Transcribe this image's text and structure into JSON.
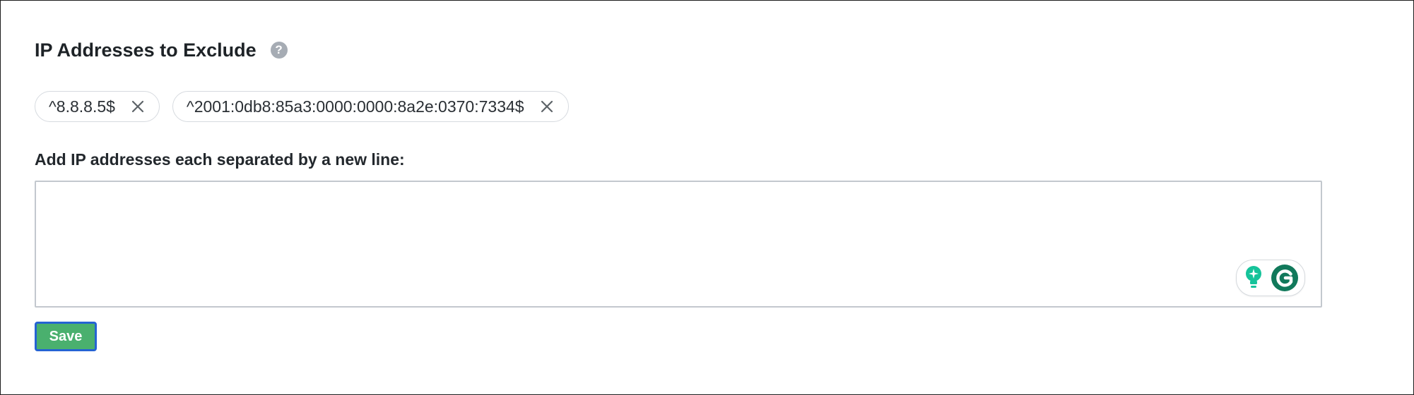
{
  "section": {
    "title": "IP Addresses to Exclude",
    "help_icon": "?",
    "chips": [
      {
        "value": "^8.8.8.5$"
      },
      {
        "value": "^2001:0db8:85a3:0000:0000:8a2e:0370:7334$"
      }
    ],
    "textarea_label": "Add IP addresses each separated by a new line:",
    "textarea_value": "",
    "save_label": "Save"
  },
  "icons": {
    "help": "question-circle-icon",
    "chip_remove": "close-icon",
    "grammarly_suggestion": "lightbulb-icon",
    "grammarly_logo": "grammarly-logo-icon"
  },
  "colors": {
    "save_button_bg": "#4ab06e",
    "save_button_border": "#2563d3",
    "grammarly_green": "#15c39a",
    "grammarly_dark": "#11795b",
    "help_icon": "#a6acb4"
  }
}
